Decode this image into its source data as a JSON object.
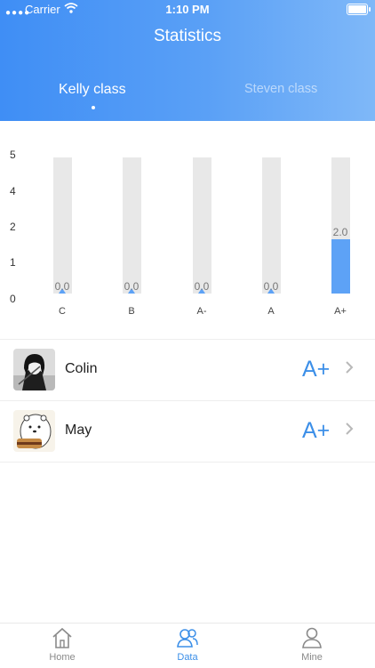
{
  "status_bar": {
    "carrier": "Carrier",
    "time": "1:10 PM"
  },
  "header": {
    "title": "Statistics"
  },
  "tabs": [
    {
      "label": "Kelly class",
      "active": true
    },
    {
      "label": "Steven class",
      "active": false
    }
  ],
  "chart_data": {
    "type": "bar",
    "categories": [
      "C",
      "B",
      "A-",
      "A",
      "A+"
    ],
    "values": [
      0.0,
      0.0,
      0.0,
      0.0,
      2.0
    ],
    "value_labels": [
      "0.0",
      "0.0",
      "0.0",
      "0.0",
      "2.0"
    ],
    "y_ticks": [
      "5",
      "4",
      "2",
      "1",
      "0"
    ],
    "ylim": [
      0,
      5
    ],
    "bar_color": "#5da2f6",
    "track_color": "#e8e8e8"
  },
  "students": [
    {
      "name": "Colin",
      "grade": "A+"
    },
    {
      "name": "May",
      "grade": "A+"
    }
  ],
  "tabbar": {
    "items": [
      {
        "label": "Home",
        "icon": "home-icon",
        "active": false
      },
      {
        "label": "Data",
        "icon": "data-icon",
        "active": true
      },
      {
        "label": "Mine",
        "icon": "person-icon",
        "active": false
      }
    ],
    "active_color": "#3c8fe8",
    "inactive_color": "#8a8a8a"
  }
}
